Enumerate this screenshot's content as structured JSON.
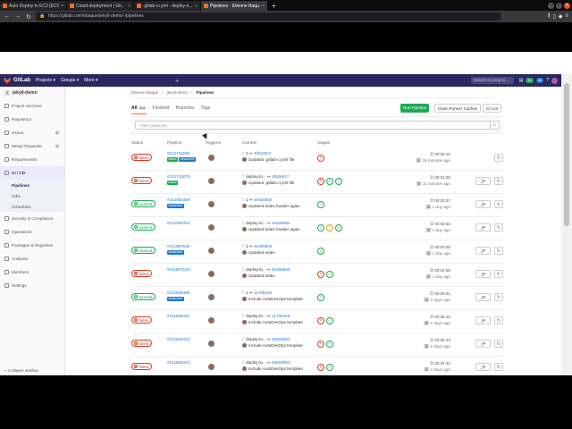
{
  "browser": {
    "tabs": [
      {
        "title": "Auto Deploy to EC2 [ECS...",
        "active": false
      },
      {
        "title": "Cloud deployment | Git...",
        "active": false
      },
      {
        "title": ".gitlab-ci.yml · deploy-k...",
        "active": false
      },
      {
        "title": "Pipelines · Etienne Baqu...",
        "active": true
      }
    ],
    "new_tab": "+",
    "url": "https://gitlab.com/ebaque/jekyll-demo/-/pipelines"
  },
  "header": {
    "logo_text": "GitLab",
    "menus": [
      "Projects ▾",
      "Groups ▾",
      "More ▾"
    ],
    "search_placeholder": "Search or jump to...",
    "badge_green": "18",
    "badge_blue": "68"
  },
  "sidebar": {
    "project_initial": "J",
    "project_name": "jekyll-demo",
    "items": [
      {
        "label": "Project overview",
        "icon": "home-icon"
      },
      {
        "label": "Repository",
        "icon": "doc-icon"
      },
      {
        "label": "Issues",
        "icon": "issues-icon",
        "count": "0"
      },
      {
        "label": "Merge Requests",
        "icon": "merge-icon",
        "count": "0"
      },
      {
        "label": "Requirements",
        "icon": "list-icon"
      },
      {
        "label": "CI / CD",
        "icon": "rocket-icon",
        "active": true
      }
    ],
    "sub_items": [
      {
        "label": "Pipelines",
        "active": true
      },
      {
        "label": "Jobs"
      },
      {
        "label": "Schedules"
      }
    ],
    "items2": [
      {
        "label": "Security & Compliance",
        "icon": "shield-icon"
      },
      {
        "label": "Operations",
        "icon": "cloud-icon"
      },
      {
        "label": "Packages & Registries",
        "icon": "package-icon"
      },
      {
        "label": "Analytics",
        "icon": "chart-icon"
      },
      {
        "label": "Members",
        "icon": "users-icon"
      },
      {
        "label": "Settings",
        "icon": "gear-icon"
      }
    ],
    "collapse": "« Collapse sidebar"
  },
  "breadcrumb": [
    "Etienne Baqué",
    "jekyll-demo",
    "Pipelines"
  ],
  "tabs": [
    {
      "label": "All",
      "count": "114",
      "active": true
    },
    {
      "label": "Finished"
    },
    {
      "label": "Branches"
    },
    {
      "label": "Tags"
    }
  ],
  "buttons": {
    "run": "Run Pipeline",
    "clear": "Clear Runner Caches",
    "lint": "CI Lint"
  },
  "filter_placeholder": "Filter pipelines",
  "columns": [
    "Status",
    "Pipeline",
    "Triggerer",
    "Commit",
    "Stages"
  ],
  "rows": [
    {
      "status": "failed",
      "id": "#212715084",
      "tags": [
        "latest",
        "detached"
      ],
      "line1_prefix": "ᚴ 1 ↦",
      "sha": "4f52e817",
      "message": "Updated .gitlab-ci.yml file",
      "stages": [
        "failed"
      ],
      "duration": "⏱ 00:00:16",
      "ago": "🗓 26 minutes ago",
      "actions": false
    },
    {
      "status": "failed",
      "id": "#212715075",
      "tags": [
        "latest"
      ],
      "line1_prefix": "ᚴ deploy-to... ↦",
      "sha": "4f52e817",
      "message": "Updated .gitlab-ci.yml file",
      "stages": [
        "failed",
        "passed",
        "passed"
      ],
      "duration": "⏱ 00:04:55",
      "ago": "🗓 11 minutes ago",
      "actions": true
    },
    {
      "status": "passed",
      "id": "#212052469",
      "tags": [
        "detached"
      ],
      "line1_prefix": "ᚴ 1 ↦",
      "sha": "2e6d09be",
      "message": "Updated index header again",
      "stages": [
        "passed"
      ],
      "duration": "⏱ 00:00:37",
      "ago": "🗓 1 day ago",
      "actions": true
    },
    {
      "status": "passed",
      "id": "#212052461",
      "tags": [],
      "line1_prefix": "ᚴ deploy-to... ↦",
      "sha": "2e6d09be",
      "message": "Updated index header again",
      "stages": [
        "passed",
        "warning",
        "passed"
      ],
      "duration": "⏱ 00:05:53",
      "ago": "🗓 1 day ago",
      "actions": true
    },
    {
      "status": "passed",
      "id": "#211587529",
      "tags": [
        "detached"
      ],
      "line1_prefix": "ᚴ 1 ↦",
      "sha": "8238d6eb",
      "message": "Updated index",
      "stages": [
        "passed"
      ],
      "duration": "⏱ 00:00:55",
      "ago": "🗓 1 day ago",
      "actions": true
    },
    {
      "status": "failed",
      "id": "#211587519",
      "tags": [],
      "line1_prefix": "ᚴ deploy-to... ↦",
      "sha": "8238d6eb",
      "message": "Updated index",
      "stages": [
        "failed",
        "passed"
      ],
      "duration": "⏱ 00:04:58",
      "ago": "🗓 1 day ago",
      "actions": true
    },
    {
      "status": "passed",
      "id": "#211586499",
      "tags": [
        "detached"
      ],
      "line1_prefix": "ᚴ 1 ↦",
      "sha": "1176b3e6",
      "message": "Include AutoDevOps template",
      "stages": [
        "passed"
      ],
      "duration": "⏱ 00:00:51",
      "ago": "🗓 2 days ago",
      "actions": true
    },
    {
      "status": "failed",
      "id": "#211586494",
      "tags": [],
      "line1_prefix": "ᚴ deploy-to... ↦",
      "sha": "1176b3e6",
      "message": "Include AutoDevOps template",
      "stages": [
        "failed",
        "passed"
      ],
      "duration": "⏱ 00:05:10",
      "ago": "🗓 2 days ago",
      "actions": true
    },
    {
      "status": "failed",
      "id": "#211585333",
      "tags": [],
      "line1_prefix": "ᚴ deploy-to... ↦",
      "sha": "9280d903",
      "message": "Include AutoDevOps template",
      "stages": [
        "failed",
        "passed"
      ],
      "duration": "⏱ 00:05:13",
      "ago": "🗓 2 days ago",
      "actions": true
    },
    {
      "status": "failed",
      "id": "#211585323",
      "tags": [],
      "line1_prefix": "ᚴ deploy-to... ↦",
      "sha": "9280d903",
      "message": "Include AutoDevOps template",
      "stages": [
        "failed",
        "passed"
      ],
      "duration": "⏱ 00:04:34",
      "ago": "🗓 2 days ago",
      "actions": true
    }
  ],
  "status_labels": {
    "failed": "failed",
    "passed": "passed"
  },
  "colors": {
    "failed": "#db3b21",
    "passed": "#1aaa55",
    "warning": "#fc9403",
    "header": "#292961",
    "accent": "#fc6d26",
    "link": "#1f78d1"
  }
}
